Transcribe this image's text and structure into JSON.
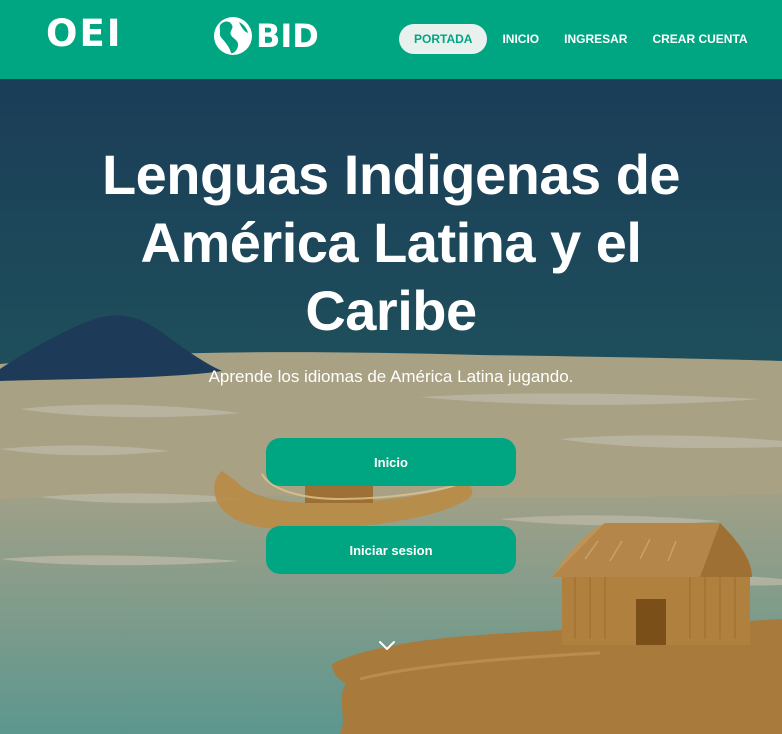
{
  "header": {
    "logo_oei": "OEI",
    "logo_bid": "BID",
    "nav": {
      "portada": "PORTADA",
      "inicio": "INICIO",
      "ingresar": "INGRESAR",
      "crear_cuenta": "CREAR CUENTA"
    }
  },
  "hero": {
    "title_line1": "Lenguas Indigenas de",
    "title_line2": "América Latina y el",
    "title_line3": "Caribe",
    "subtitle": "Aprende los idiomas de América Latina jugando.",
    "btn_inicio": "Inicio",
    "btn_login": "Iniciar sesion",
    "scroll_icon": "chevron-down-icon"
  },
  "colors": {
    "brand_green": "#00a682",
    "active_pill": "#e9f1ef",
    "sky_top": "#1b3d58",
    "sky_bottom": "#22665f",
    "sand": "#a9a184",
    "water": "#5f9a93",
    "hut": "#b0803e"
  }
}
